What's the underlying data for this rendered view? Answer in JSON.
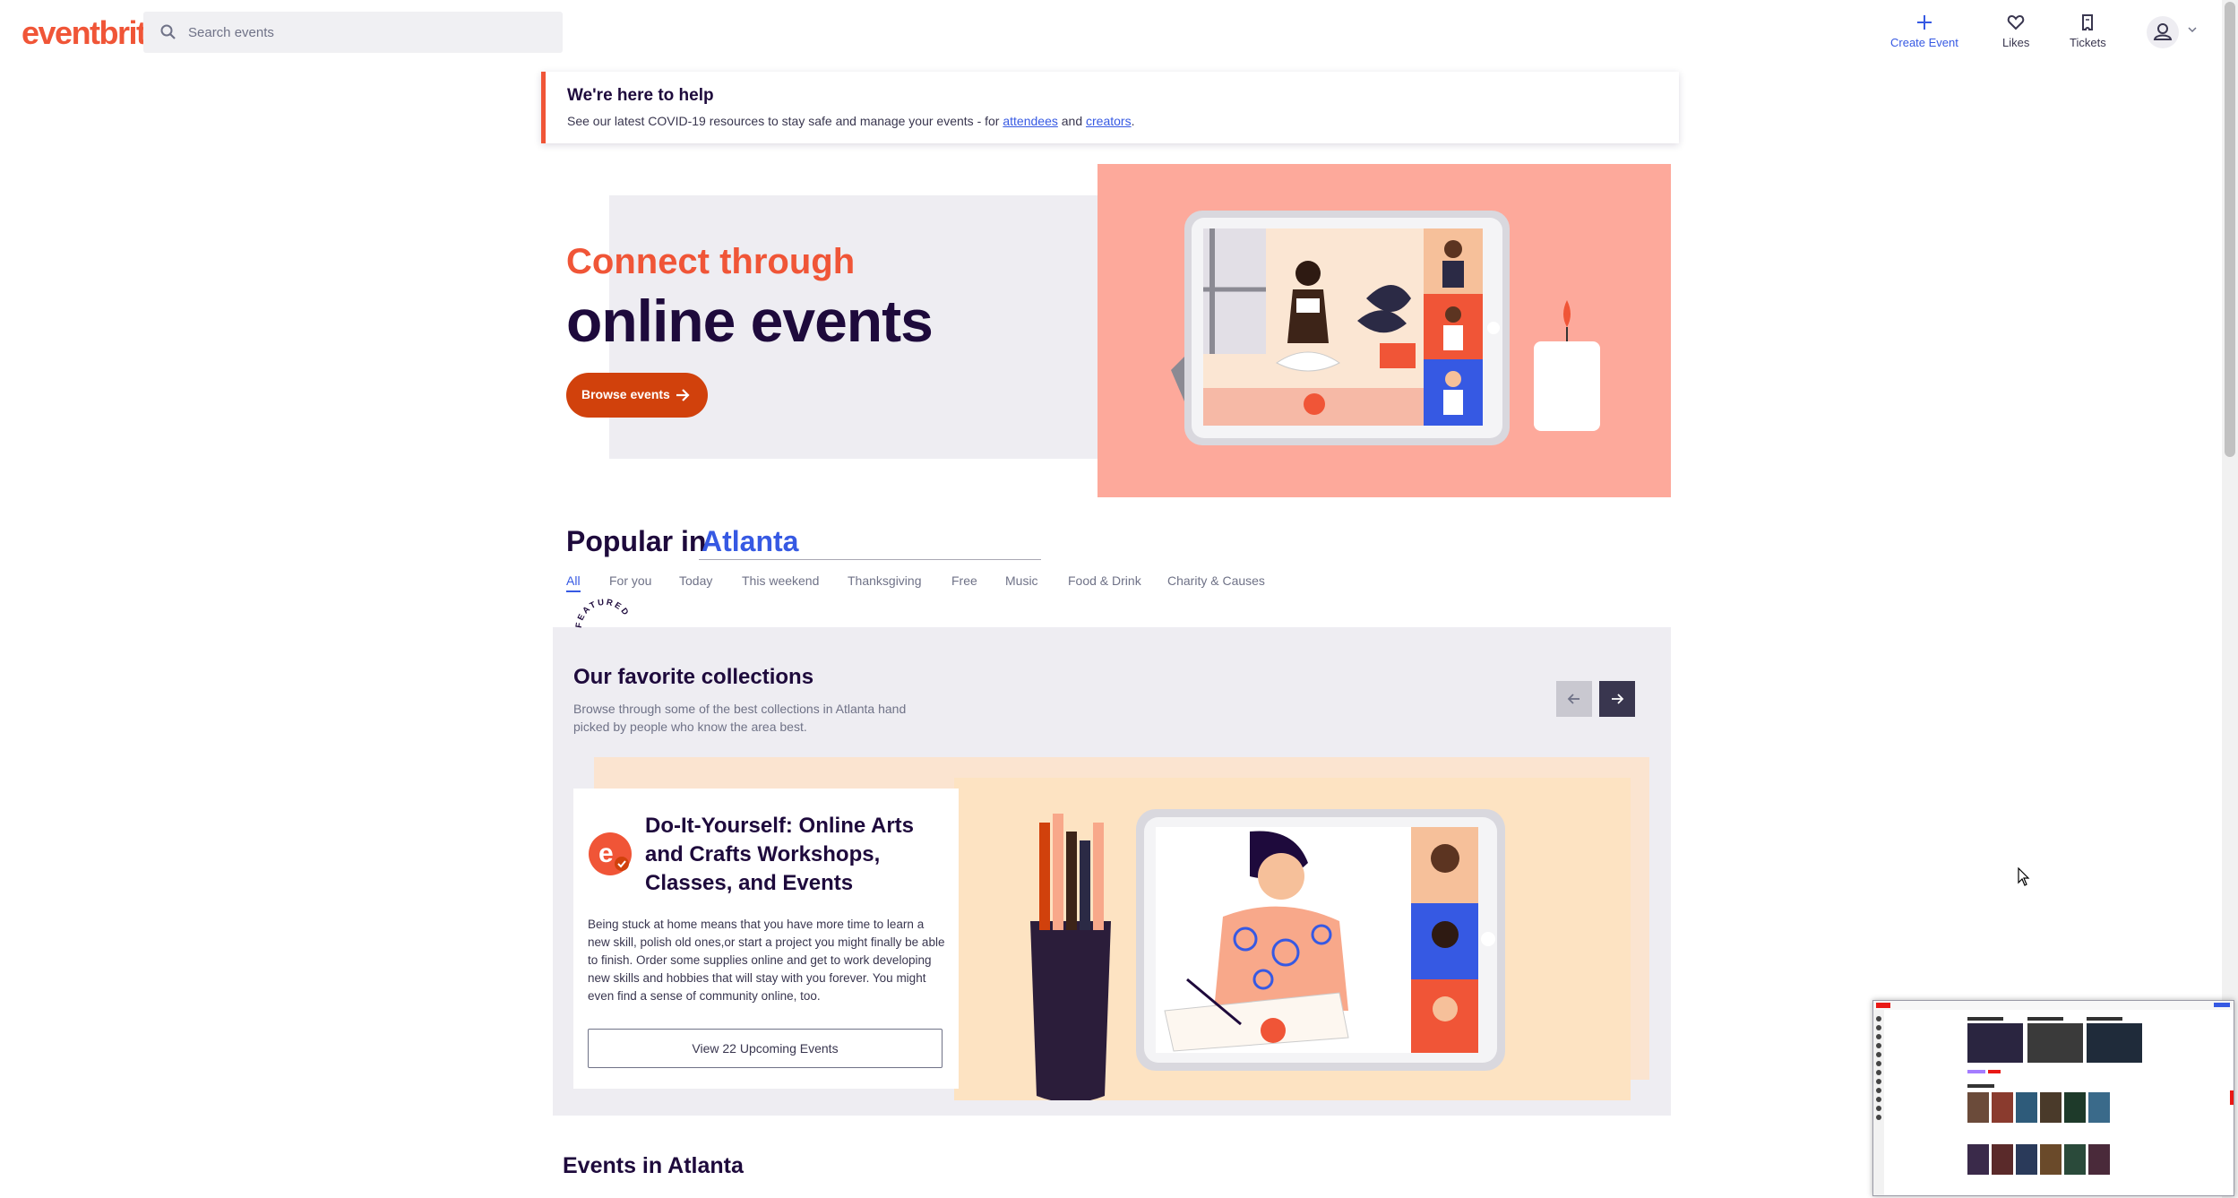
{
  "header": {
    "logo": "eventbrite",
    "search_placeholder": "Search events",
    "nav": {
      "create": "Create Event",
      "likes": "Likes",
      "tickets": "Tickets"
    }
  },
  "banner": {
    "title": "We're here to help",
    "text_prefix": "See our latest COVID-19 resources to stay safe and manage your events - for",
    "link_attendees": "attendees",
    "text_and": "and",
    "link_creators": "creators",
    "text_suffix": "."
  },
  "hero": {
    "line1": "Connect through",
    "line2": "online events",
    "button": "Browse events"
  },
  "popular": {
    "title": "Popular in",
    "city": "Atlanta",
    "tabs": [
      "All",
      "For you",
      "Today",
      "This weekend",
      "Thanksgiving",
      "Free",
      "Music",
      "Food & Drink",
      "Charity & Causes"
    ],
    "active_tab": "All"
  },
  "collections": {
    "badge": "FEATURED",
    "title": "Our favorite collections",
    "description": "Browse through some of the best collections in Atlanta hand picked by people who know the area best.",
    "card": {
      "title": "Do-It-Yourself: Online Arts and Crafts Workshops, Classes, and Events",
      "text": "Being stuck at home means that you have more time to learn a new skill, polish old ones,or start a project you might finally be able to finish. Order some supplies online and get to work developing new skills and hobbies that will stay with you forever. You might even find a sense of community online, too.",
      "button": "View 22 Upcoming Events"
    }
  },
  "events": {
    "title": "Events in Atlanta"
  },
  "mini_window": {
    "brand_color": "#e91916"
  },
  "colors": {
    "brand": "#f05537",
    "accent_blue": "#3659e3",
    "button_orange": "#d1410c",
    "dark": "#1e0a3c",
    "hero_pink": "#fda99b"
  }
}
